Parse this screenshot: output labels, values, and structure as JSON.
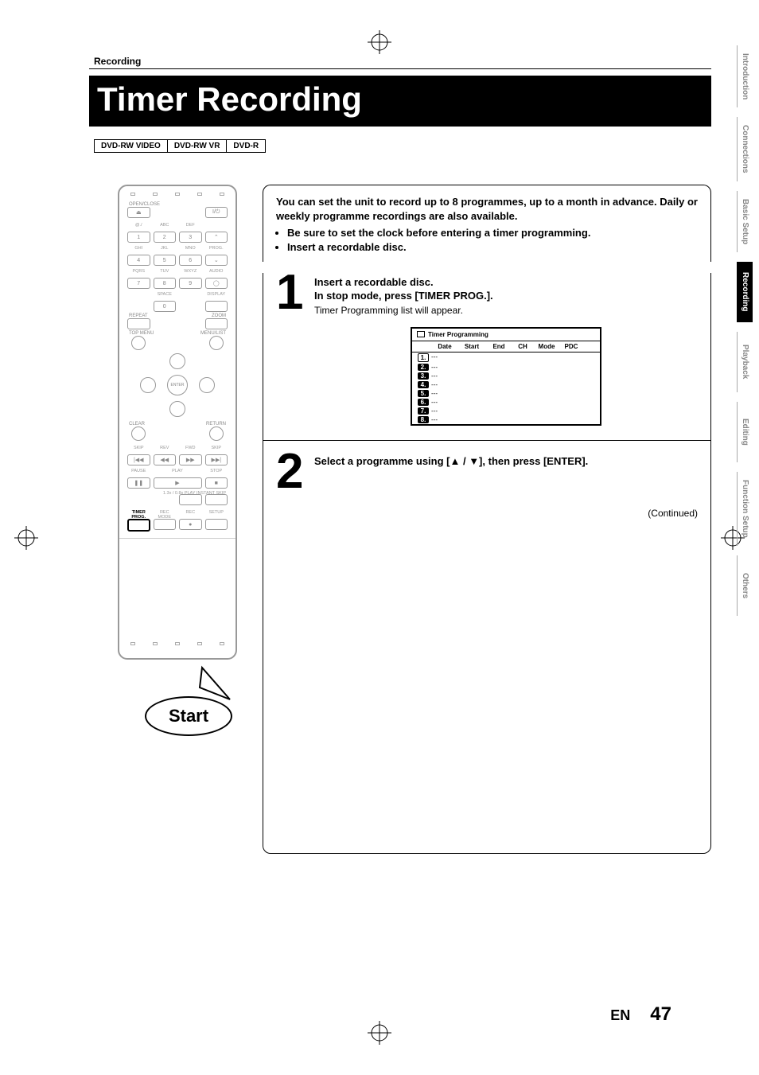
{
  "crumb": "Recording",
  "title": "Timer Recording",
  "media_tags": [
    "DVD-RW VIDEO",
    "DVD-RW VR",
    "DVD-R"
  ],
  "intro": {
    "lead": "You can set the unit to record up to 8 programmes, up to a month in advance. Daily or weekly programme recordings are also available.",
    "bullets": [
      "Be sure to set the clock before entering a timer programming.",
      "Insert a recordable disc."
    ]
  },
  "steps": [
    {
      "num": "1",
      "heading_lines": [
        "Insert a recordable disc.",
        "In stop mode, press [TIMER PROG.]."
      ],
      "sub": "Timer Programming list will appear."
    },
    {
      "num": "2",
      "heading_lines": [
        "Select a programme using [▲ / ▼], then press [ENTER]."
      ],
      "sub": ""
    }
  ],
  "timer_table": {
    "title": "Timer Programming",
    "headers": [
      "",
      "Date",
      "Start",
      "End",
      "CH",
      "Mode",
      "PDC"
    ],
    "rows": [
      {
        "n": "1.",
        "date": "---"
      },
      {
        "n": "2.",
        "date": "---"
      },
      {
        "n": "3.",
        "date": "---"
      },
      {
        "n": "4.",
        "date": "---"
      },
      {
        "n": "5.",
        "date": "---"
      },
      {
        "n": "6.",
        "date": "---"
      },
      {
        "n": "7.",
        "date": "---"
      },
      {
        "n": "8.",
        "date": "---"
      }
    ]
  },
  "continued": "(Continued)",
  "tabs": [
    {
      "label": "Introduction",
      "active": false
    },
    {
      "label": "Connections",
      "active": false
    },
    {
      "label": "Basic Setup",
      "active": false
    },
    {
      "label": "Recording",
      "active": true
    },
    {
      "label": "Playback",
      "active": false
    },
    {
      "label": "Editing",
      "active": false
    },
    {
      "label": "Function Setup",
      "active": false
    },
    {
      "label": "Others",
      "active": false
    }
  ],
  "footer": {
    "lang": "EN",
    "page": "47"
  },
  "start_callout": "Start",
  "remote": {
    "row1_labels": [
      "OPEN/CLOSE",
      "",
      "",
      ""
    ],
    "keypad_labels": [
      [
        "@./",
        "ABC",
        "DEF",
        ""
      ],
      [
        "GHI",
        "JKL",
        "MNO",
        "PROG."
      ],
      [
        "PQRS",
        "TUV",
        "WXYZ",
        "AUDIO"
      ],
      [
        "",
        "SPACE",
        "",
        "DISPLAY"
      ]
    ],
    "keypad_nums": [
      [
        "1",
        "2",
        "3",
        "⌃"
      ],
      [
        "4",
        "5",
        "6",
        "⌄"
      ],
      [
        "7",
        "8",
        "9",
        "◯"
      ],
      [
        "",
        "0",
        "",
        ""
      ]
    ],
    "mid_labels_left": "REPEAT",
    "mid_labels_right": "ZOOM",
    "menu_left": "TOP MENU",
    "menu_right": "MENU/LIST",
    "clear": "CLEAR",
    "return": "RETURN",
    "enter": "ENTER",
    "transport_labels": [
      "SKIP",
      "REV",
      "FWD",
      "SKIP"
    ],
    "transport2_labels": [
      "PAUSE",
      "PLAY",
      "",
      "STOP"
    ],
    "transport3": "1.3x / 0.8x PLAY   INSTANT SKIP",
    "bottom_labels": [
      "TIMER PROG.",
      "REC MODE",
      "REC",
      "SETUP"
    ],
    "power": "I/⏻",
    "eject": "⏏"
  }
}
